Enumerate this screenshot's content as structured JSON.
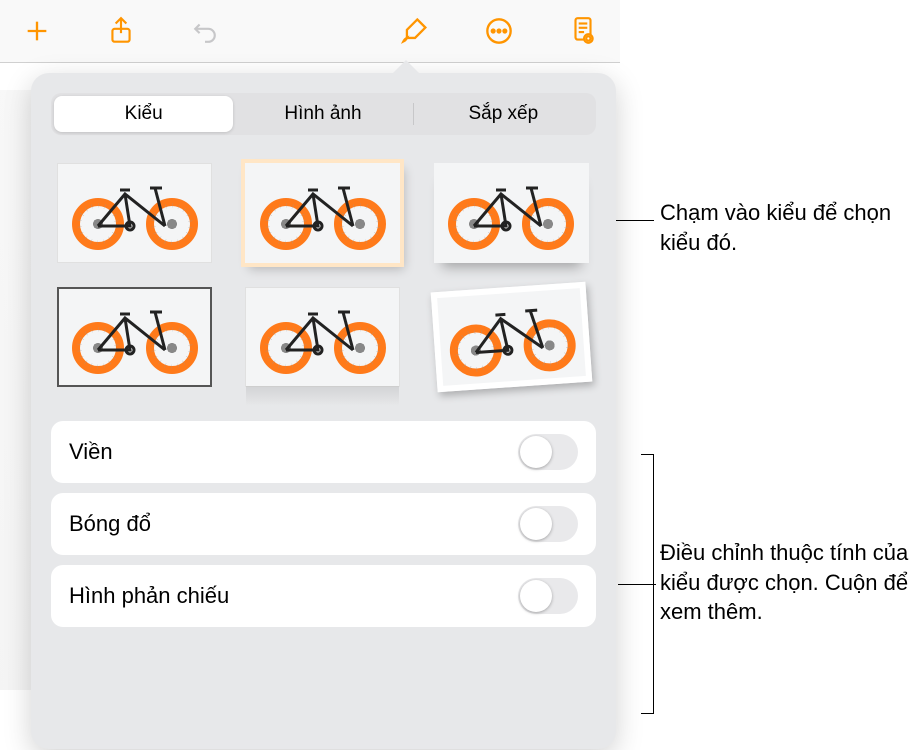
{
  "toolbar": {
    "icons": {
      "add": "add-icon",
      "share": "share-icon",
      "undo": "undo-icon",
      "format": "paintbrush-icon",
      "more": "more-icon",
      "document": "document-icon"
    }
  },
  "popover": {
    "tabs": [
      {
        "label": "Kiểu",
        "active": true
      },
      {
        "label": "Hình ảnh",
        "active": false
      },
      {
        "label": "Sắp xếp",
        "active": false
      }
    ],
    "options": [
      {
        "label": "Viền",
        "on": false
      },
      {
        "label": "Bóng đổ",
        "on": false
      },
      {
        "label": "Hình phản chiếu",
        "on": false
      }
    ]
  },
  "callouts": {
    "c1": "Chạm vào kiểu để chọn kiểu đó.",
    "c2": "Điều chỉnh thuộc tính của kiểu được chọn. Cuộn để xem thêm."
  }
}
